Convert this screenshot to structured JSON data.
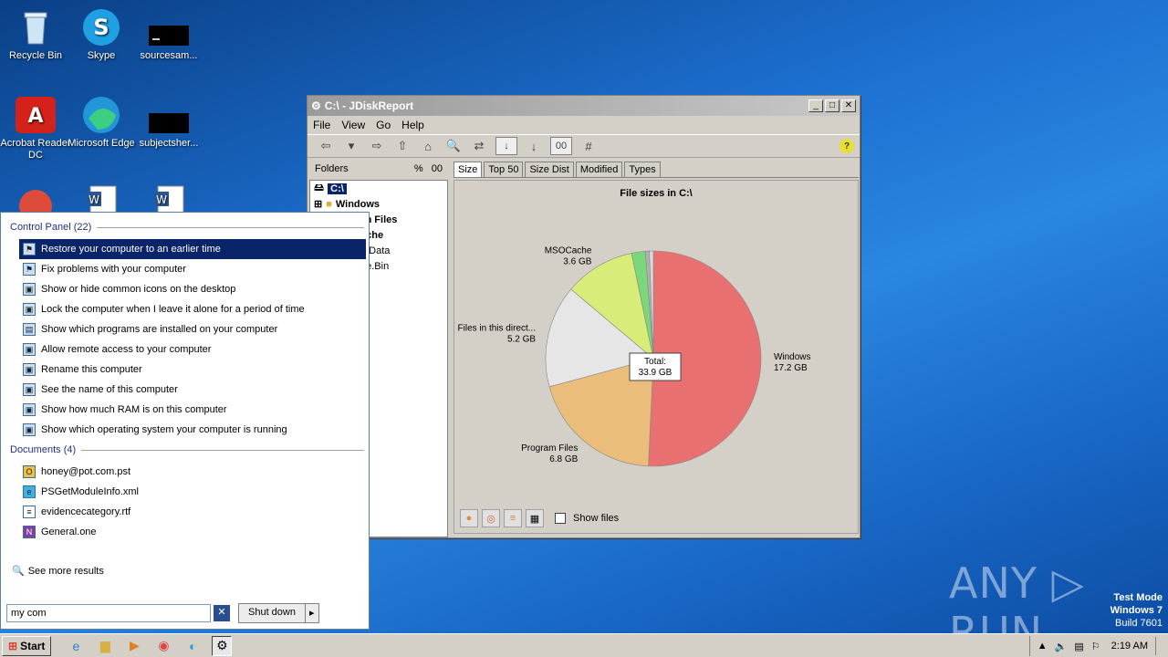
{
  "desktop": {
    "icons": [
      {
        "label": "Recycle Bin"
      },
      {
        "label": "Skype"
      },
      {
        "label": "sourcesam..."
      },
      {
        "label": "Acrobat Reader DC"
      },
      {
        "label": "Microsoft Edge"
      },
      {
        "label": "subjectsher..."
      }
    ],
    "watermark": "ANY ▷ RUN",
    "testmode": {
      "line1": "Test Mode",
      "line2": "Windows 7",
      "line3": "Build 7601"
    }
  },
  "window": {
    "title": "C:\\ - JDiskReport",
    "menu": [
      "File",
      "View",
      "Go",
      "Help"
    ],
    "toolbar": {
      "order_box": "00",
      "hash": "#"
    },
    "left": {
      "header": "Folders",
      "pct": "%",
      "zeros": "00",
      "tree": [
        {
          "label": "C:\\",
          "selected": true
        },
        {
          "label": "Windows"
        },
        {
          "label": "Program Files"
        },
        {
          "label": "MSOCache"
        },
        {
          "label": "ProgramData"
        },
        {
          "label": "$Recycle.Bin"
        }
      ]
    },
    "tabs": [
      "Size",
      "Top 50",
      "Size Dist",
      "Modified",
      "Types"
    ],
    "chart_title": "File sizes in C:\\",
    "show_files": "Show files"
  },
  "chart_data": {
    "type": "pie",
    "title": "File sizes in C:\\",
    "total_label": "Total:",
    "total_value": "33.9 GB",
    "slices": [
      {
        "name": "Windows",
        "value": 17.2,
        "label": "17.2 GB",
        "color": "#e87070"
      },
      {
        "name": "Program Files",
        "value": 6.8,
        "label": "6.8 GB",
        "color": "#eabd7a"
      },
      {
        "name": "Files in this direct...",
        "value": 5.2,
        "label": "5.2 GB",
        "color": "#e6e6e6"
      },
      {
        "name": "MSOCache",
        "value": 3.6,
        "label": "3.6 GB",
        "color": "#d8ec7a"
      },
      {
        "name": "",
        "value": 0.7,
        "label": "",
        "color": "#7ad87a"
      },
      {
        "name": "",
        "value": 0.2,
        "label": "",
        "color": "#b0b0b0"
      },
      {
        "name": "",
        "value": 0.2,
        "label": "",
        "color": "#d8d8d8"
      }
    ]
  },
  "startmenu": {
    "cp_header": "Control Panel (22)",
    "cp_items": [
      "Restore your computer to an earlier time",
      "Fix problems with your computer",
      "Show or hide common icons on the desktop",
      "Lock the computer when I leave it alone for a period of time",
      "Show which programs are installed on your computer",
      "Allow remote access to your computer",
      "Rename this computer",
      "See the name of this computer",
      "Show how much RAM is on this computer",
      "Show which operating system your computer is running"
    ],
    "doc_header": "Documents (4)",
    "doc_items": [
      "honey@pot.com.pst",
      "PSGetModuleInfo.xml",
      "evidencecategory.rtf",
      "General.one"
    ],
    "see_more": "See more results",
    "search_value": "my com",
    "shutdown": "Shut down"
  },
  "taskbar": {
    "start": "Start",
    "clock": "2:19 AM"
  }
}
